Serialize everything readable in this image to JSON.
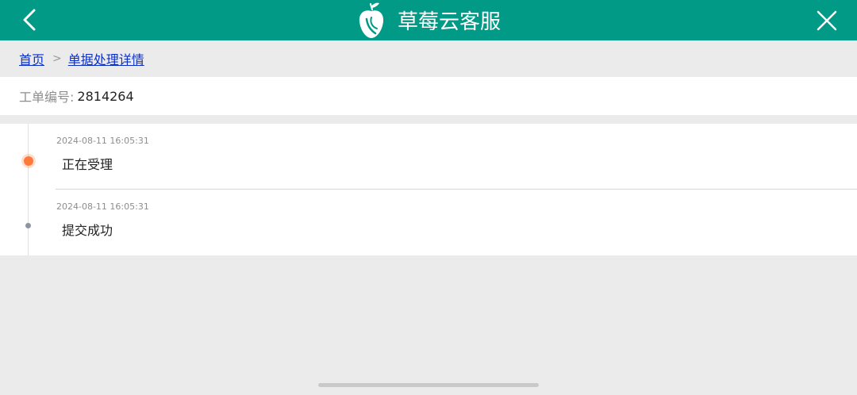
{
  "header": {
    "title": "草莓云客服",
    "back_icon": "chevron-left-icon",
    "close_icon": "close-icon",
    "logo_icon": "strawberry-logo",
    "color": "#009a86"
  },
  "breadcrumb": {
    "home": "首页",
    "separator": ">",
    "current": "单据处理详情"
  },
  "ticket": {
    "label": "工单编号:",
    "number": "2814264"
  },
  "timeline": {
    "items": [
      {
        "time": "2024-08-11 16:05:31",
        "status": "正在受理",
        "active": true,
        "dot_color": "#ff7a3a"
      },
      {
        "time": "2024-08-11 16:05:31",
        "status": "提交成功",
        "active": false,
        "dot_color": "#8c96a3"
      }
    ]
  }
}
